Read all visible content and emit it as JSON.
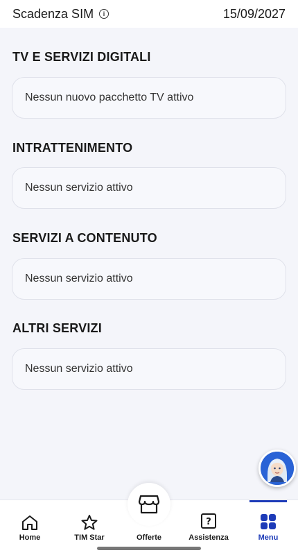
{
  "topbar": {
    "sim_label": "Scadenza SIM",
    "sim_date": "15/09/2027",
    "info_icon": "info-icon"
  },
  "sections": [
    {
      "title": "TV E SERVIZI DIGITALI",
      "card_text": "Nessun nuovo pacchetto TV attivo"
    },
    {
      "title": "INTRATTENIMENTO",
      "card_text": "Nessun servizio attivo"
    },
    {
      "title": "SERVIZI A CONTENUTO",
      "card_text": "Nessun servizio attivo"
    },
    {
      "title": "ALTRI SERVIZI",
      "card_text": "Nessun servizio attivo"
    }
  ],
  "nav": {
    "active": "Menu",
    "accent_color": "#1d3bb8",
    "items": [
      {
        "label": "Home",
        "icon": "home-icon"
      },
      {
        "label": "TIM Star",
        "icon": "star-icon"
      },
      {
        "label": "Offerte",
        "icon": "store-icon"
      },
      {
        "label": "Assistenza",
        "icon": "help-icon"
      },
      {
        "label": "Menu",
        "icon": "grid-icon"
      }
    ]
  },
  "assistant": {
    "icon": "assistant-avatar-icon"
  }
}
